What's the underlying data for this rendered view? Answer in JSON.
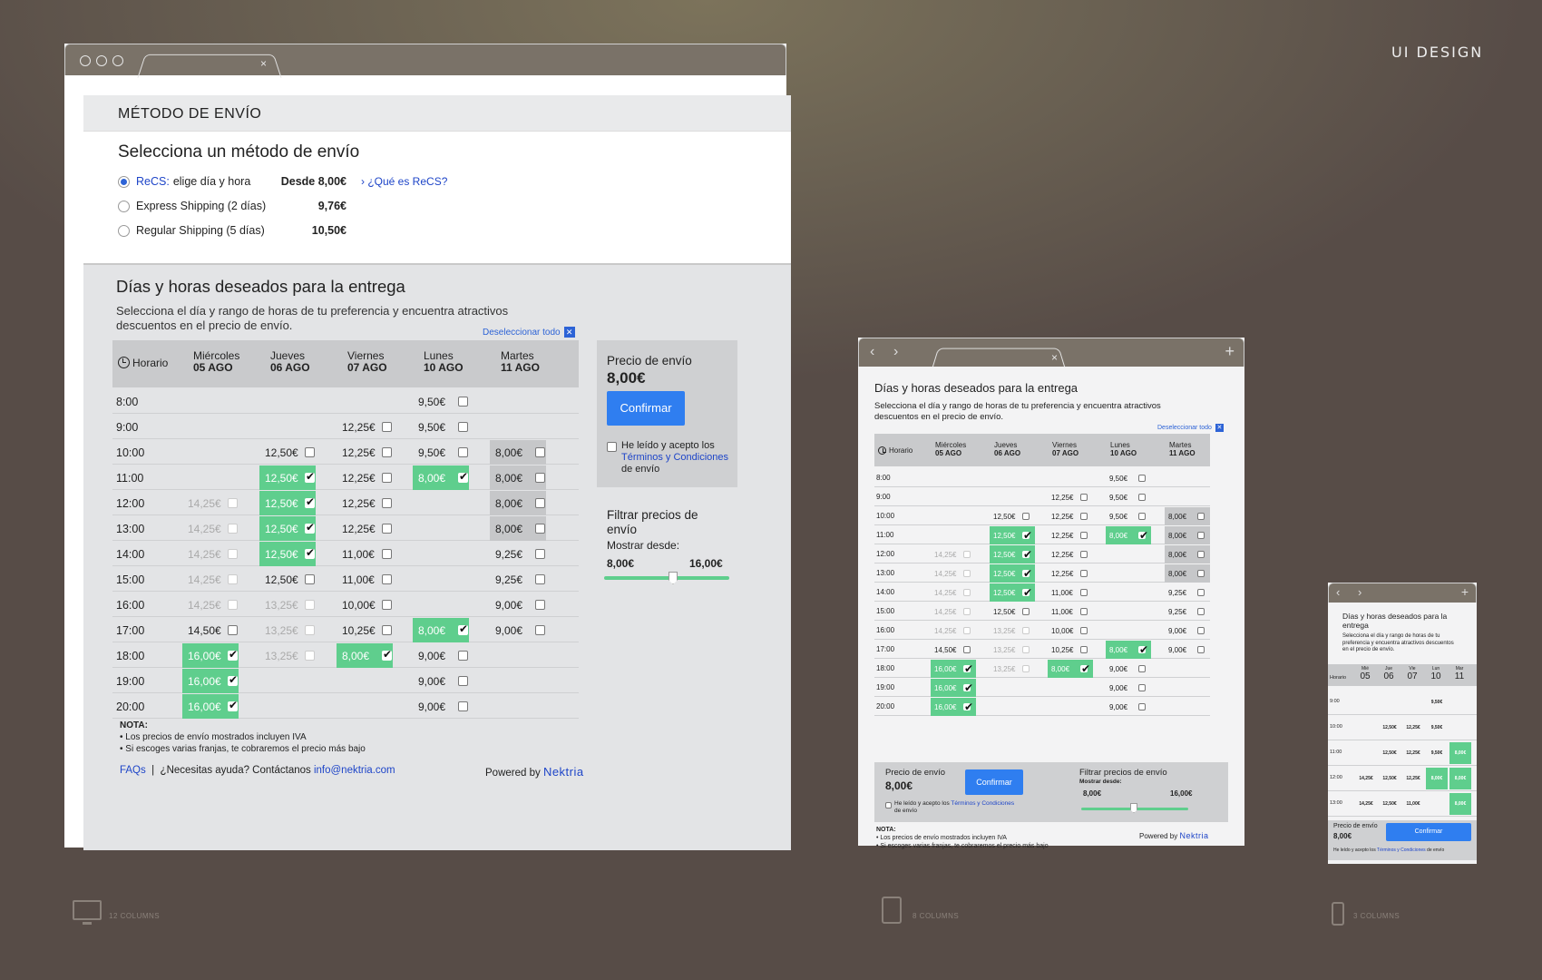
{
  "brand_title": "UI DESIGN",
  "desktop": {
    "header": "MÉTODO DE ENVÍO",
    "shipping_title": "Selecciona un método de envío",
    "options": [
      {
        "name_link": "ReCS:",
        "name": "elige día y hora",
        "price": "Desde 8,00€",
        "link": "› ¿Qué es ReCS?",
        "selected": true
      },
      {
        "name": "Express Shipping (2 días)",
        "price": "9,76€",
        "selected": false
      },
      {
        "name": "Regular Shipping (5 días)",
        "price": "10,50€",
        "selected": false
      }
    ],
    "section_title": "Días y horas deseados para la entrega",
    "section_desc": "Selecciona el día y rango de horas de tu preferencia y encuentra atractivos descuentos en el precio de envío.",
    "deselect_label": "Deseleccionar todo",
    "deselect_icon": "close-icon",
    "horario_label": "Horario",
    "days": [
      {
        "day": "Miércoles",
        "date": "05 AGO"
      },
      {
        "day": "Jueves",
        "date": "06 AGO"
      },
      {
        "day": "Viernes",
        "date": "07 AGO"
      },
      {
        "day": "Lunes",
        "date": "10 AGO"
      },
      {
        "day": "Martes",
        "date": "11 AGO"
      }
    ],
    "times": [
      "8:00",
      "9:00",
      "10:00",
      "11:00",
      "12:00",
      "13:00",
      "14:00",
      "15:00",
      "16:00",
      "17:00",
      "18:00",
      "19:00",
      "20:00"
    ],
    "price_box": {
      "title": "Precio de envío",
      "price": "8,00€",
      "confirm": "Confirmar",
      "terms_prefix": "He leído y acepto los",
      "terms_link": "Términos y Condiciones",
      "terms_suffix": "de envío"
    },
    "filter": {
      "title": "Filtrar precios de envío",
      "show_from": "Mostrar desde:",
      "min": "8,00€",
      "max": "16,00€"
    },
    "notes": {
      "title": "NOTA:",
      "lines": [
        "• Los precios de envío mostrados incluyen IVA",
        "• Si escoges varias franjas, te cobraremos el precio más bajo"
      ]
    },
    "footer": {
      "faqs": "FAQs",
      "sep": "|",
      "help": "¿Necesitas ayuda? Contáctanos",
      "email": "info@nektria.com",
      "powered": "Powered by",
      "brand": "Nektria"
    }
  },
  "tablet": {
    "section_title": "Días y horas deseados para la entrega",
    "section_desc": "Selecciona el día y rango de horas de tu preferencia y encuentra atractivos descuentos en el precio de envío.",
    "deselect_label": "Deseleccionar todo",
    "price_title": "Precio de envío",
    "price": "8,00€",
    "confirm": "Confirmar",
    "terms_prefix": "He leído y acepto los",
    "terms_link": "Términos y Condiciones",
    "terms_suffix": "de envío",
    "filter_title": "Filtrar precios de envío",
    "show_from": "Mostrar desde:",
    "min": "8,00€",
    "max": "16,00€",
    "note_title": "NOTA:",
    "note_lines": [
      "• Los precios de envío mostrados incluyen IVA",
      "• Si escoges varias franjas, te cobraremos el precio más bajo"
    ],
    "powered": "Powered by",
    "brand": "Nektria"
  },
  "mobile": {
    "section_title": "Días y horas deseados para la entrega",
    "section_desc": "Selecciona el día y rango de horas de tu preferencia y encuentra atractivos descuentos en el precio de envío.",
    "horario": "Horario",
    "days": [
      {
        "d": "Mié",
        "n": "05"
      },
      {
        "d": "Jue",
        "n": "06"
      },
      {
        "d": "Vie",
        "n": "07"
      },
      {
        "d": "Lun",
        "n": "10"
      },
      {
        "d": "Mar",
        "n": "11"
      }
    ],
    "times": [
      "9:00",
      "10:00",
      "11:00",
      "12:00",
      "13:00"
    ],
    "price_title": "Precio de envío",
    "price": "8,00€",
    "confirm": "Confirmar",
    "terms_prefix": "He leído y acepto los",
    "terms_link": "Términos y Condiciones",
    "terms_suffix": "de envío"
  },
  "column_labels": [
    "12 COLUMNS",
    "8 COLUMNS",
    "3 COLUMNS"
  ],
  "grid": {
    "rows": [
      [
        "",
        "",
        "",
        {
          "p": "9,50€",
          "s": "n"
        },
        ""
      ],
      [
        "",
        "",
        {
          "p": "12,25€",
          "s": "n"
        },
        {
          "p": "9,50€",
          "s": "n"
        },
        ""
      ],
      [
        "",
        {
          "p": "12,50€",
          "s": "n"
        },
        {
          "p": "12,25€",
          "s": "n"
        },
        {
          "p": "9,50€",
          "s": "n"
        },
        {
          "p": "8,00€",
          "s": "g"
        }
      ],
      [
        "",
        {
          "p": "12,50€",
          "s": "c"
        },
        {
          "p": "12,25€",
          "s": "n"
        },
        {
          "p": "8,00€",
          "s": "c"
        },
        {
          "p": "8,00€",
          "s": "g"
        }
      ],
      [
        {
          "p": "14,25€",
          "s": "f"
        },
        {
          "p": "12,50€",
          "s": "c"
        },
        {
          "p": "12,25€",
          "s": "n"
        },
        "",
        {
          "p": "8,00€",
          "s": "g"
        }
      ],
      [
        {
          "p": "14,25€",
          "s": "f"
        },
        {
          "p": "12,50€",
          "s": "c"
        },
        {
          "p": "12,25€",
          "s": "n"
        },
        "",
        {
          "p": "8,00€",
          "s": "g"
        }
      ],
      [
        {
          "p": "14,25€",
          "s": "f"
        },
        {
          "p": "12,50€",
          "s": "c"
        },
        {
          "p": "11,00€",
          "s": "n"
        },
        "",
        {
          "p": "9,25€",
          "s": "n"
        }
      ],
      [
        {
          "p": "14,25€",
          "s": "f"
        },
        {
          "p": "12,50€",
          "s": "n"
        },
        {
          "p": "11,00€",
          "s": "n"
        },
        "",
        {
          "p": "9,25€",
          "s": "n"
        }
      ],
      [
        {
          "p": "14,25€",
          "s": "f"
        },
        {
          "p": "13,25€",
          "s": "f"
        },
        {
          "p": "10,00€",
          "s": "n"
        },
        "",
        {
          "p": "9,00€",
          "s": "n"
        }
      ],
      [
        {
          "p": "14,50€",
          "s": "n"
        },
        {
          "p": "13,25€",
          "s": "f"
        },
        {
          "p": "10,25€",
          "s": "n"
        },
        {
          "p": "8,00€",
          "s": "c"
        },
        {
          "p": "9,00€",
          "s": "n"
        }
      ],
      [
        {
          "p": "16,00€",
          "s": "c"
        },
        {
          "p": "13,25€",
          "s": "f"
        },
        {
          "p": "8,00€",
          "s": "c"
        },
        {
          "p": "9,00€",
          "s": "n"
        },
        ""
      ],
      [
        {
          "p": "16,00€",
          "s": "c"
        },
        "",
        "",
        {
          "p": "9,00€",
          "s": "n"
        },
        ""
      ],
      [
        {
          "p": "16,00€",
          "s": "c"
        },
        "",
        "",
        {
          "p": "9,00€",
          "s": "n"
        },
        ""
      ]
    ]
  },
  "mobile_grid": [
    [
      "",
      "",
      "",
      {
        "p": "9,50€",
        "s": "n"
      },
      ""
    ],
    [
      "",
      {
        "p": "12,50€",
        "s": "n"
      },
      {
        "p": "12,25€",
        "s": "n"
      },
      {
        "p": "9,50€",
        "s": "n"
      },
      ""
    ],
    [
      "",
      {
        "p": "12,50€",
        "s": "n"
      },
      {
        "p": "12,25€",
        "s": "n"
      },
      {
        "p": "9,50€",
        "s": "n"
      },
      {
        "p": "8,00€",
        "s": "c"
      }
    ],
    [
      {
        "p": "14,25€",
        "s": "n"
      },
      {
        "p": "12,50€",
        "s": "n"
      },
      {
        "p": "12,25€",
        "s": "n"
      },
      {
        "p": "8,00€",
        "s": "c"
      },
      {
        "p": "8,00€",
        "s": "c"
      }
    ],
    [
      {
        "p": "14,25€",
        "s": "n"
      },
      {
        "p": "12,50€",
        "s": "n"
      },
      {
        "p": "11,00€",
        "s": "n"
      },
      "",
      {
        "p": "8,00€",
        "s": "c"
      }
    ]
  ]
}
